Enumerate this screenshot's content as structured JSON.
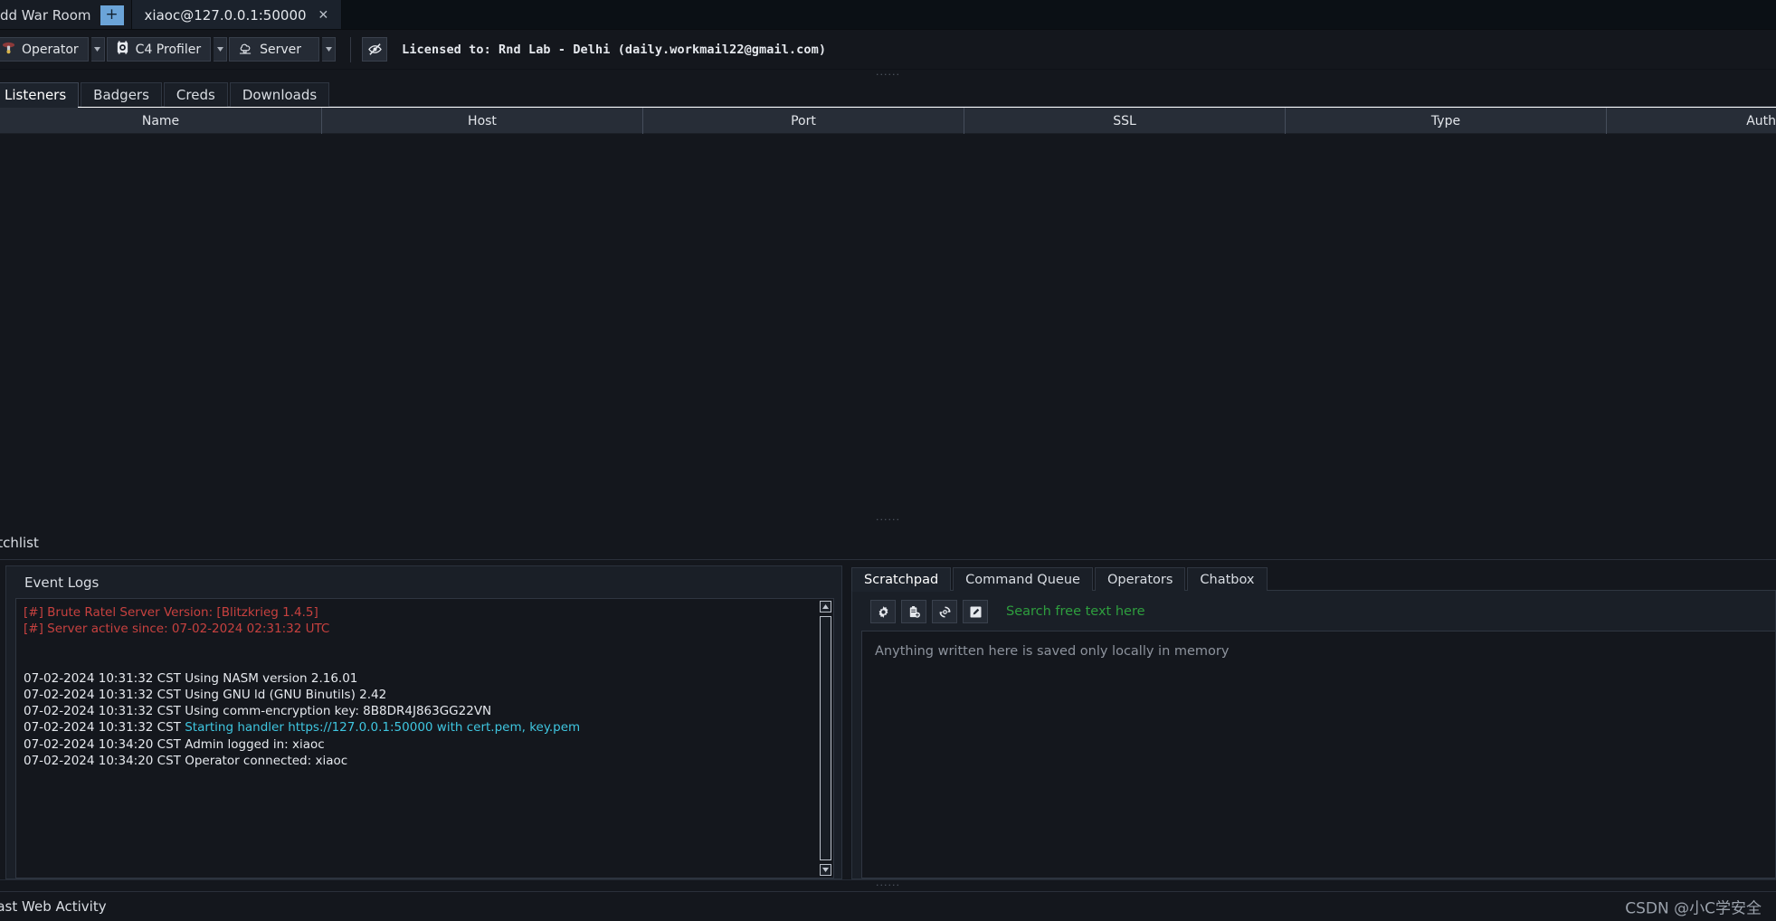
{
  "window": {
    "warroom": {
      "label": "dd War Room",
      "plus": "+"
    },
    "session_tab": {
      "label": "xiaoc@127.0.0.1:50000",
      "close": "✕"
    }
  },
  "toolbar": {
    "combos": [
      {
        "label": "Operator",
        "icon": "operator-icon"
      },
      {
        "label": "C4 Profiler",
        "icon": "c4-profiler-icon"
      },
      {
        "label": "Server",
        "icon": "server-cloud-icon"
      }
    ],
    "visibility_icon": "eye-slash-icon",
    "license": "Licensed to: Rnd Lab - Delhi (daily.workmail22@gmail.com)"
  },
  "main": {
    "tabs": [
      {
        "label": "Listeners",
        "active": true
      },
      {
        "label": "Badgers",
        "active": false
      },
      {
        "label": "Creds",
        "active": false
      },
      {
        "label": "Downloads",
        "active": false
      }
    ],
    "table": {
      "columns": [
        "Name",
        "Host",
        "Port",
        "SSL",
        "Type",
        "Auth"
      ],
      "rows": []
    }
  },
  "watchlist": {
    "label": "atchlist"
  },
  "logs": {
    "title": "Event Logs",
    "lines": [
      {
        "text": "[#] Brute Ratel Server Version: [Blitzkrieg 1.4.5]",
        "style": "red"
      },
      {
        "text": "[#] Server active since: 07-02-2024 02:31:32 UTC",
        "style": "red"
      },
      {
        "text": "",
        "style": "blank"
      },
      {
        "text": "",
        "style": "blank"
      },
      {
        "text": "07-02-2024 10:31:32 CST Using NASM version 2.16.01",
        "style": "plain"
      },
      {
        "text": "07-02-2024 10:31:32 CST Using GNU ld (GNU Binutils) 2.42",
        "style": "plain"
      },
      {
        "text": "07-02-2024 10:31:32 CST Using comm-encryption key: 8B8DR4J863GG22VN",
        "style": "plain"
      },
      {
        "prefix": "07-02-2024 10:31:32 CST ",
        "text": "Starting handler https://127.0.0.1:50000 with cert.pem, key.pem",
        "style": "cyan"
      },
      {
        "text": "07-02-2024 10:34:20 CST Admin logged in: xiaoc",
        "style": "plain"
      },
      {
        "text": "07-02-2024 10:34:20 CST Operator connected: xiaoc",
        "style": "plain"
      }
    ]
  },
  "right": {
    "tabs": [
      {
        "label": "Scratchpad",
        "active": true
      },
      {
        "label": "Command Queue",
        "active": false
      },
      {
        "label": "Operators",
        "active": false
      },
      {
        "label": "Chatbox",
        "active": false
      }
    ],
    "buttons": [
      {
        "icon": "gear-icon",
        "name": "settings-button"
      },
      {
        "icon": "clipboard-add-icon",
        "name": "clipboard-add-button"
      },
      {
        "icon": "sync-icon",
        "name": "sync-button"
      },
      {
        "icon": "edit-pencil-icon",
        "name": "edit-button"
      }
    ],
    "search_label": "Search free text here",
    "scratchpad_placeholder": "Anything written here is saved only locally in memory"
  },
  "footer": {
    "label": "Last Web Activity",
    "watermark": "CSDN @小C学安全"
  },
  "colors": {
    "accent_blue": "#6ba4d8",
    "log_red": "#c7413f",
    "log_cyan": "#3fc6e0",
    "search_green": "#2e9e3e"
  }
}
